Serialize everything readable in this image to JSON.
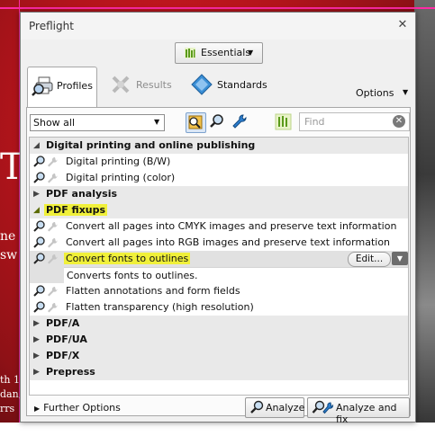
{
  "background": {
    "fragments": [
      "T",
      "ne",
      "sw",
      "th 1",
      "dan,",
      "rrs"
    ]
  },
  "dialog": {
    "title": "Preflight",
    "close_glyph": "✕",
    "essentials_label": "Essentials",
    "tabs": [
      {
        "label": "Profiles",
        "icon": "printer-magnifier-icon",
        "active": true
      },
      {
        "label": "Results",
        "icon": "results-wrench-icon",
        "active": false
      },
      {
        "label": "Standards",
        "icon": "diamond-icon",
        "active": false
      }
    ],
    "options_label": "Options",
    "filter": {
      "value": "Show all"
    },
    "find": {
      "placeholder": "Find"
    },
    "tree": {
      "group_digital": "Digital printing and online publishing",
      "item_digital_bw": "Digital printing (B/W)",
      "item_digital_color": "Digital printing (color)",
      "group_pdf_analysis": "PDF analysis",
      "group_pdf_fixups": "PDF fixups",
      "item_cmyk": "Convert all pages into CMYK images and preserve text information",
      "item_rgb": "Convert all pages into RGB images and preserve text information",
      "item_fonts": "Convert fonts to outlines",
      "item_fonts_desc": "Converts fonts to outlines.",
      "edit_label": "Edit...",
      "item_flatten_annot": "Flatten annotations and form fields",
      "item_flatten_transp": "Flatten transparency (high resolution)",
      "group_pdfa": "PDF/A",
      "group_pdfua": "PDF/UA",
      "group_pdfx": "PDF/X",
      "group_prepress": "Prepress"
    },
    "further_options": "Further Options",
    "analyze_label": "Analyze",
    "analyze_fix_label": "Analyze and fix"
  },
  "colors": {
    "highlight": "#f0f03a",
    "background_red": "#b3141b",
    "guide_pink": "#ff2aa6"
  }
}
